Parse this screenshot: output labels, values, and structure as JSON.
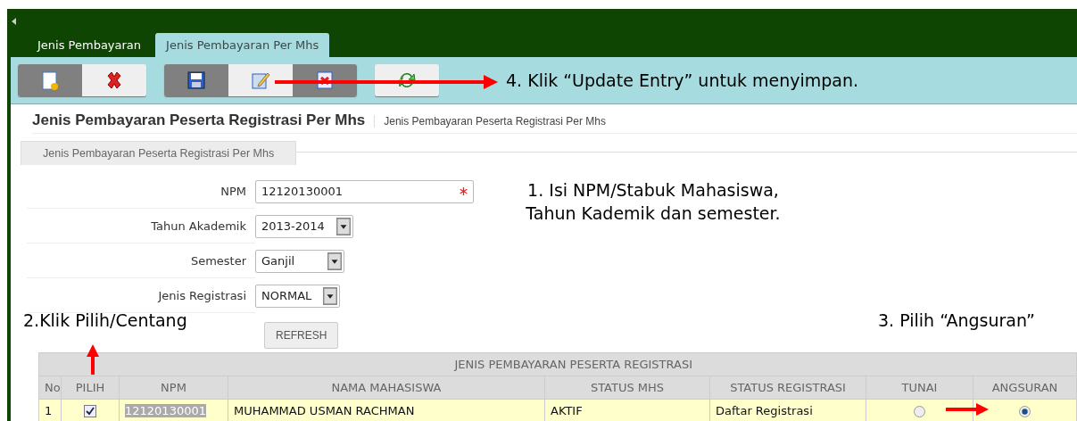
{
  "tabs": [
    {
      "label": "Jenis Pembayaran",
      "selected": false
    },
    {
      "label": "Jenis Pembayaran Per Mhs",
      "selected": true
    }
  ],
  "toolbar": [
    {
      "buttons": [
        {
          "kind": "new",
          "disabled": true
        },
        {
          "kind": "delete",
          "disabled": false
        }
      ]
    },
    {
      "buttons": [
        {
          "kind": "save",
          "disabled": true
        },
        {
          "kind": "edit",
          "disabled": false
        },
        {
          "kind": "cancel",
          "disabled": true
        }
      ]
    },
    {
      "buttons": [
        {
          "kind": "refresh",
          "disabled": false
        }
      ]
    }
  ],
  "page_title": "Jenis Pembayaran Peserta Registrasi Per Mhs",
  "breadcrumb": "Jenis Pembayaran Peserta Registrasi Per Mhs",
  "panel_tab": "Jenis Pembayaran Peserta Registrasi Per Mhs",
  "form": {
    "fields": [
      {
        "kind": "text",
        "label": "NPM",
        "value": "12120130001",
        "required": true
      },
      {
        "kind": "select",
        "label": "Tahun Akademik",
        "value": "2013-2014"
      },
      {
        "kind": "select",
        "label": "Semester",
        "value": "Ganjil"
      },
      {
        "kind": "select",
        "label": "Jenis Registrasi",
        "value": "NORMAL"
      }
    ],
    "button": "REFRESH"
  },
  "table": {
    "group_header": "JENIS PEMBAYARAN PESERTA REGISTRASI",
    "columns": [
      "No",
      "PILIH",
      "NPM",
      "NAMA MAHASISWA",
      "STATUS MHS",
      "STATUS REGISTRASI",
      "TUNAI",
      "ANGSURAN"
    ],
    "rows": [
      {
        "no": "1",
        "checked": true,
        "npm": "12120130001",
        "npm_highlighted": true,
        "name": "MUHAMMAD USMAN RACHMAN",
        "status_mhs": "AKTIF",
        "status_registrasi": "Daftar Registrasi",
        "tunai_selected": false,
        "angsuran_selected": true
      }
    ]
  },
  "annotations": [
    {
      "kind": "step4",
      "text": "4. Klik “Update Entry” untuk menyimpan."
    },
    {
      "kind": "step1",
      "text": "1. Isi NPM/Stabuk Mahasiswa, Tahun Kademik dan semester."
    },
    {
      "kind": "step2",
      "text": "2.Klik Pilih/Centang"
    },
    {
      "kind": "step3",
      "text": "3. Pilih “Angsuran”"
    }
  ]
}
